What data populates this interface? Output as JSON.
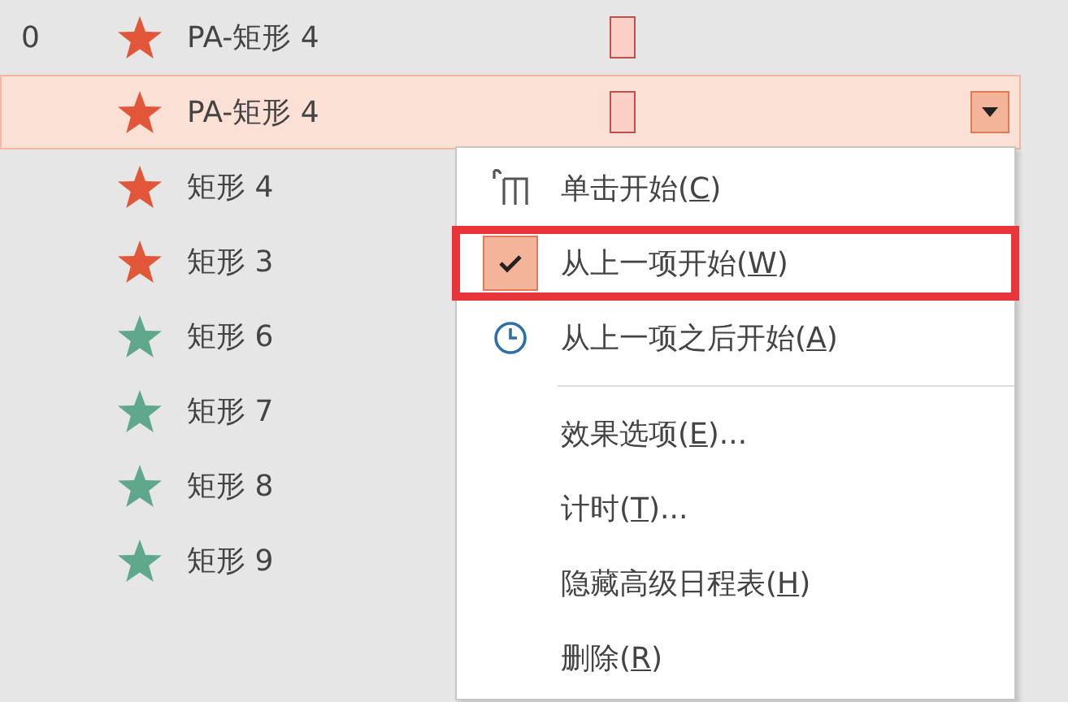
{
  "animation_list": [
    {
      "number": "0",
      "name": "PA-矩形 4",
      "color": "#e2573a",
      "selected": false,
      "timing": true
    },
    {
      "name": "PA-矩形 4",
      "color": "#e2573a",
      "selected": true,
      "timing": true
    },
    {
      "name": "矩形 4",
      "color": "#e2573a",
      "selected": false,
      "timing": false
    },
    {
      "name": "矩形 3",
      "color": "#e2573a",
      "selected": false,
      "timing": false
    },
    {
      "name": "矩形 6",
      "color": "#5fa88c",
      "selected": false,
      "timing": false
    },
    {
      "name": "矩形 7",
      "color": "#5fa88c",
      "selected": false,
      "timing": false
    },
    {
      "name": "矩形 8",
      "color": "#5fa88c",
      "selected": false,
      "timing": false
    },
    {
      "name": "矩形 9",
      "color": "#5fa88c",
      "selected": false,
      "timing": false
    }
  ],
  "context_menu": {
    "items": [
      {
        "kind": "click",
        "label": "单击开始(C)",
        "checked": false,
        "highlighted": false
      },
      {
        "kind": "check",
        "label": "从上一项开始(W)",
        "checked": true,
        "highlighted": true
      },
      {
        "kind": "clock",
        "label": "从上一项之后开始(A)",
        "checked": false,
        "highlighted": false
      },
      {
        "kind": "separator"
      },
      {
        "kind": "plain",
        "label": "效果选项(E)...",
        "checked": false,
        "highlighted": false
      },
      {
        "kind": "plain",
        "label": "计时(T)...",
        "checked": false,
        "highlighted": false
      },
      {
        "kind": "plain",
        "label": "隐藏高级日程表(H)",
        "checked": false,
        "highlighted": false
      },
      {
        "kind": "plain",
        "label": "删除(R)",
        "checked": false,
        "highlighted": false
      }
    ]
  }
}
